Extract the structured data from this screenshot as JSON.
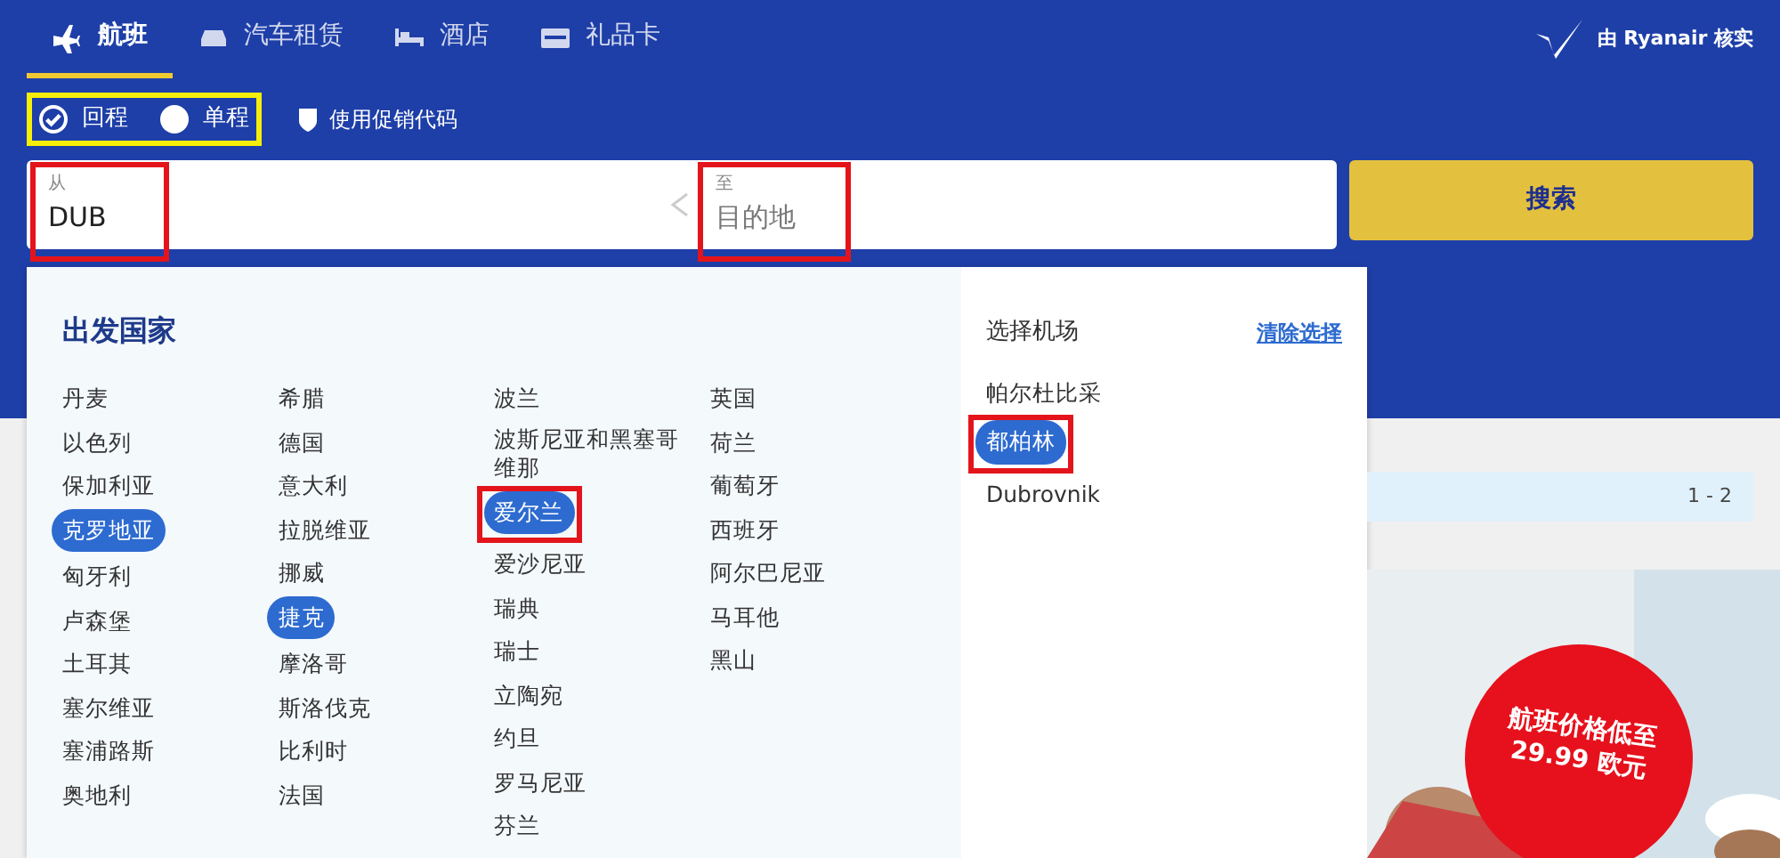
{
  "tabs": [
    {
      "label": "航班",
      "kind": "plane",
      "selected": true
    },
    {
      "label": "汽车租赁",
      "kind": "car",
      "selected": false
    },
    {
      "label": "酒店",
      "kind": "bed",
      "selected": false
    },
    {
      "label": "礼品卡",
      "kind": "card",
      "selected": false
    }
  ],
  "verified": {
    "text": "由 Ryanair 核实"
  },
  "trip_type": {
    "highlighted": true,
    "options": [
      {
        "label": "回程",
        "selected": true
      },
      {
        "label": "单程",
        "selected": false
      }
    ]
  },
  "promo": {
    "label": "使用促销代码"
  },
  "from_field": {
    "label": "从",
    "value": "DUB",
    "highlighted": true
  },
  "to_field": {
    "label": "至",
    "placeholder": "目的地",
    "highlighted": true
  },
  "search_button": "搜索",
  "countries_panel": {
    "title": "出发国家",
    "columns": [
      {
        "items": [
          {
            "name": "丹麦",
            "selected": false,
            "highlighted": false
          },
          {
            "name": "以色列",
            "selected": false,
            "highlighted": false
          },
          {
            "name": "保加利亚",
            "selected": false,
            "highlighted": false
          },
          {
            "name": "克罗地亚",
            "selected": true,
            "highlighted": false
          },
          {
            "name": "匈牙利",
            "selected": false,
            "highlighted": false
          },
          {
            "name": "卢森堡",
            "selected": false,
            "highlighted": false
          },
          {
            "name": "土耳其",
            "selected": false,
            "highlighted": false
          },
          {
            "name": "塞尔维亚",
            "selected": false,
            "highlighted": false
          },
          {
            "name": "塞浦路斯",
            "selected": false,
            "highlighted": false
          },
          {
            "name": "奥地利",
            "selected": false,
            "highlighted": false
          }
        ]
      },
      {
        "items": [
          {
            "name": "希腊",
            "selected": false,
            "highlighted": false
          },
          {
            "name": "德国",
            "selected": false,
            "highlighted": false
          },
          {
            "name": "意大利",
            "selected": false,
            "highlighted": false
          },
          {
            "name": "拉脱维亚",
            "selected": false,
            "highlighted": false
          },
          {
            "name": "挪威",
            "selected": false,
            "highlighted": false
          },
          {
            "name": "捷克",
            "selected": true,
            "highlighted": false
          },
          {
            "name": "摩洛哥",
            "selected": false,
            "highlighted": false
          },
          {
            "name": "斯洛伐克",
            "selected": false,
            "highlighted": false
          },
          {
            "name": "比利时",
            "selected": false,
            "highlighted": false
          },
          {
            "name": "法国",
            "selected": false,
            "highlighted": false
          }
        ]
      },
      {
        "items": [
          {
            "name": "波兰",
            "selected": false,
            "highlighted": false
          },
          {
            "name": "波斯尼亚和黑塞哥维那",
            "selected": false,
            "highlighted": false
          },
          {
            "name": "爱尔兰",
            "selected": true,
            "highlighted": true
          },
          {
            "name": "爱沙尼亚",
            "selected": false,
            "highlighted": false
          },
          {
            "name": "瑞典",
            "selected": false,
            "highlighted": false
          },
          {
            "name": "瑞士",
            "selected": false,
            "highlighted": false
          },
          {
            "name": "立陶宛",
            "selected": false,
            "highlighted": false
          },
          {
            "name": "约旦",
            "selected": false,
            "highlighted": false
          },
          {
            "name": "罗马尼亚",
            "selected": false,
            "highlighted": false
          },
          {
            "name": "芬兰",
            "selected": false,
            "highlighted": false
          }
        ]
      },
      {
        "items": [
          {
            "name": "英国",
            "selected": false,
            "highlighted": false
          },
          {
            "name": "荷兰",
            "selected": false,
            "highlighted": false
          },
          {
            "name": "葡萄牙",
            "selected": false,
            "highlighted": false
          },
          {
            "name": "西班牙",
            "selected": false,
            "highlighted": false
          },
          {
            "name": "阿尔巴尼亚",
            "selected": false,
            "highlighted": false
          },
          {
            "name": "马耳他",
            "selected": false,
            "highlighted": false
          },
          {
            "name": "黑山",
            "selected": false,
            "highlighted": false
          }
        ]
      }
    ]
  },
  "airports_panel": {
    "title": "选择机场",
    "clear_link": "清除选择",
    "items": [
      {
        "name": "帕尔杜比采",
        "selected": false,
        "highlighted": false
      },
      {
        "name": "都柏林",
        "selected": true,
        "highlighted": true
      },
      {
        "name": "Dubrovnik",
        "selected": false,
        "highlighted": false
      }
    ]
  },
  "pager": {
    "text": "1 - 2"
  },
  "promo_banner": {
    "badge_lines": [
      "航班价格低至",
      "29.99 欧元"
    ]
  }
}
